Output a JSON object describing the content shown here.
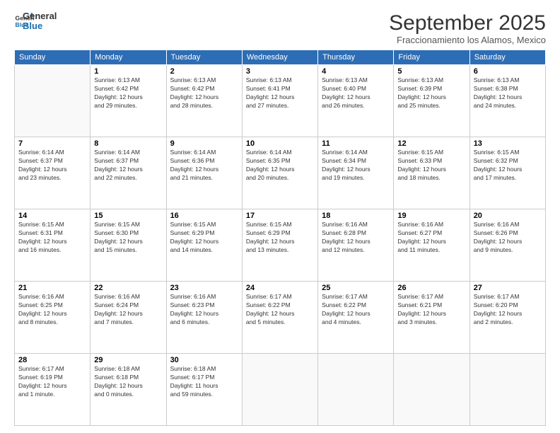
{
  "logo": {
    "line1": "General",
    "line2": "Blue"
  },
  "title": "September 2025",
  "location": "Fraccionamiento los Alamos, Mexico",
  "days_header": [
    "Sunday",
    "Monday",
    "Tuesday",
    "Wednesday",
    "Thursday",
    "Friday",
    "Saturday"
  ],
  "weeks": [
    [
      {
        "day": "",
        "info": ""
      },
      {
        "day": "1",
        "info": "Sunrise: 6:13 AM\nSunset: 6:42 PM\nDaylight: 12 hours\nand 29 minutes."
      },
      {
        "day": "2",
        "info": "Sunrise: 6:13 AM\nSunset: 6:42 PM\nDaylight: 12 hours\nand 28 minutes."
      },
      {
        "day": "3",
        "info": "Sunrise: 6:13 AM\nSunset: 6:41 PM\nDaylight: 12 hours\nand 27 minutes."
      },
      {
        "day": "4",
        "info": "Sunrise: 6:13 AM\nSunset: 6:40 PM\nDaylight: 12 hours\nand 26 minutes."
      },
      {
        "day": "5",
        "info": "Sunrise: 6:13 AM\nSunset: 6:39 PM\nDaylight: 12 hours\nand 25 minutes."
      },
      {
        "day": "6",
        "info": "Sunrise: 6:13 AM\nSunset: 6:38 PM\nDaylight: 12 hours\nand 24 minutes."
      }
    ],
    [
      {
        "day": "7",
        "info": "Sunrise: 6:14 AM\nSunset: 6:37 PM\nDaylight: 12 hours\nand 23 minutes."
      },
      {
        "day": "8",
        "info": "Sunrise: 6:14 AM\nSunset: 6:37 PM\nDaylight: 12 hours\nand 22 minutes."
      },
      {
        "day": "9",
        "info": "Sunrise: 6:14 AM\nSunset: 6:36 PM\nDaylight: 12 hours\nand 21 minutes."
      },
      {
        "day": "10",
        "info": "Sunrise: 6:14 AM\nSunset: 6:35 PM\nDaylight: 12 hours\nand 20 minutes."
      },
      {
        "day": "11",
        "info": "Sunrise: 6:14 AM\nSunset: 6:34 PM\nDaylight: 12 hours\nand 19 minutes."
      },
      {
        "day": "12",
        "info": "Sunrise: 6:15 AM\nSunset: 6:33 PM\nDaylight: 12 hours\nand 18 minutes."
      },
      {
        "day": "13",
        "info": "Sunrise: 6:15 AM\nSunset: 6:32 PM\nDaylight: 12 hours\nand 17 minutes."
      }
    ],
    [
      {
        "day": "14",
        "info": "Sunrise: 6:15 AM\nSunset: 6:31 PM\nDaylight: 12 hours\nand 16 minutes."
      },
      {
        "day": "15",
        "info": "Sunrise: 6:15 AM\nSunset: 6:30 PM\nDaylight: 12 hours\nand 15 minutes."
      },
      {
        "day": "16",
        "info": "Sunrise: 6:15 AM\nSunset: 6:29 PM\nDaylight: 12 hours\nand 14 minutes."
      },
      {
        "day": "17",
        "info": "Sunrise: 6:15 AM\nSunset: 6:29 PM\nDaylight: 12 hours\nand 13 minutes."
      },
      {
        "day": "18",
        "info": "Sunrise: 6:16 AM\nSunset: 6:28 PM\nDaylight: 12 hours\nand 12 minutes."
      },
      {
        "day": "19",
        "info": "Sunrise: 6:16 AM\nSunset: 6:27 PM\nDaylight: 12 hours\nand 11 minutes."
      },
      {
        "day": "20",
        "info": "Sunrise: 6:16 AM\nSunset: 6:26 PM\nDaylight: 12 hours\nand 9 minutes."
      }
    ],
    [
      {
        "day": "21",
        "info": "Sunrise: 6:16 AM\nSunset: 6:25 PM\nDaylight: 12 hours\nand 8 minutes."
      },
      {
        "day": "22",
        "info": "Sunrise: 6:16 AM\nSunset: 6:24 PM\nDaylight: 12 hours\nand 7 minutes."
      },
      {
        "day": "23",
        "info": "Sunrise: 6:16 AM\nSunset: 6:23 PM\nDaylight: 12 hours\nand 6 minutes."
      },
      {
        "day": "24",
        "info": "Sunrise: 6:17 AM\nSunset: 6:22 PM\nDaylight: 12 hours\nand 5 minutes."
      },
      {
        "day": "25",
        "info": "Sunrise: 6:17 AM\nSunset: 6:22 PM\nDaylight: 12 hours\nand 4 minutes."
      },
      {
        "day": "26",
        "info": "Sunrise: 6:17 AM\nSunset: 6:21 PM\nDaylight: 12 hours\nand 3 minutes."
      },
      {
        "day": "27",
        "info": "Sunrise: 6:17 AM\nSunset: 6:20 PM\nDaylight: 12 hours\nand 2 minutes."
      }
    ],
    [
      {
        "day": "28",
        "info": "Sunrise: 6:17 AM\nSunset: 6:19 PM\nDaylight: 12 hours\nand 1 minute."
      },
      {
        "day": "29",
        "info": "Sunrise: 6:18 AM\nSunset: 6:18 PM\nDaylight: 12 hours\nand 0 minutes."
      },
      {
        "day": "30",
        "info": "Sunrise: 6:18 AM\nSunset: 6:17 PM\nDaylight: 11 hours\nand 59 minutes."
      },
      {
        "day": "",
        "info": ""
      },
      {
        "day": "",
        "info": ""
      },
      {
        "day": "",
        "info": ""
      },
      {
        "day": "",
        "info": ""
      }
    ]
  ]
}
